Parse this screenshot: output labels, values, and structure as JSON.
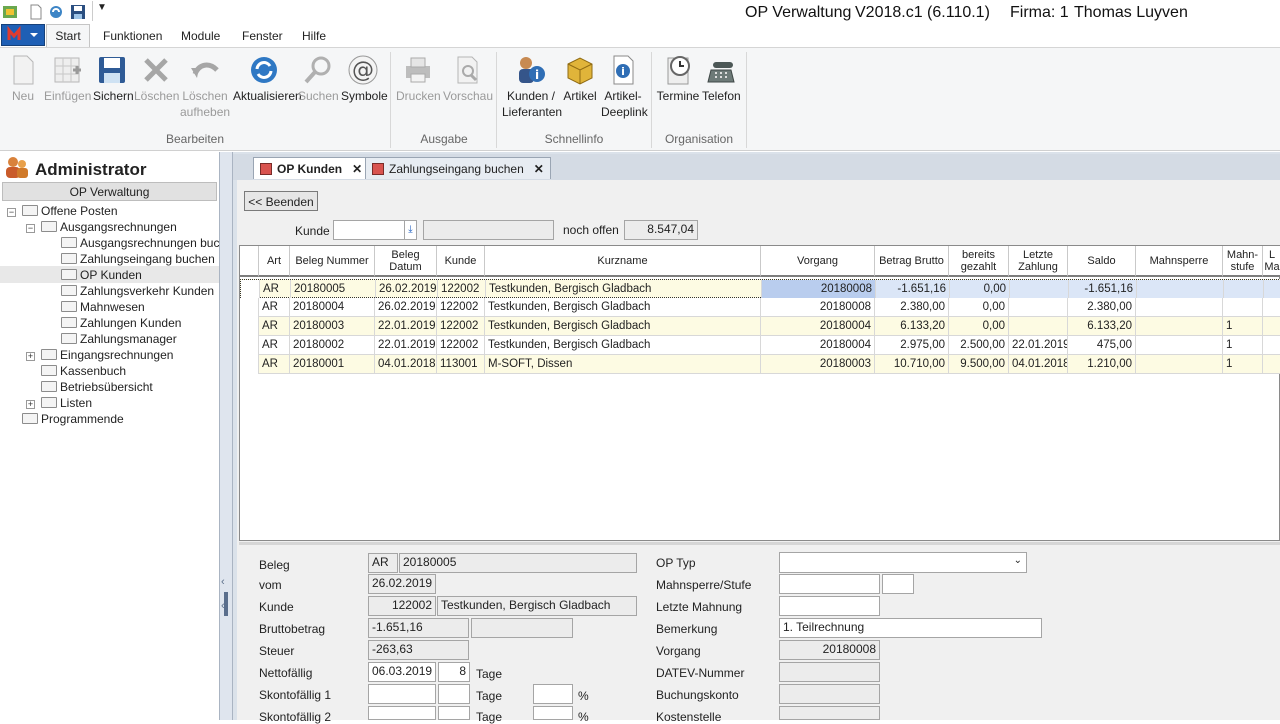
{
  "app": {
    "title": "OP Verwaltung",
    "version": "V2018.c1 (6.110.1)",
    "firma": "Firma: 1",
    "user": "Thomas Luyven"
  },
  "menu": [
    "Start",
    "Funktionen",
    "Module",
    "Fenster",
    "Hilfe"
  ],
  "ribbon": {
    "bearbeiten": {
      "label": "Bearbeiten",
      "buttons": [
        {
          "l1": "Neu",
          "l2": ""
        },
        {
          "l1": "Einfügen",
          "l2": ""
        },
        {
          "l1": "Sichern",
          "l2": ""
        },
        {
          "l1": "Löschen",
          "l2": ""
        },
        {
          "l1": "Löschen",
          "l2": "aufheben"
        },
        {
          "l1": "Aktualisieren",
          "l2": ""
        },
        {
          "l1": "Suchen",
          "l2": ""
        },
        {
          "l1": "Symbole",
          "l2": ""
        }
      ]
    },
    "ausgabe": {
      "label": "Ausgabe",
      "buttons": [
        {
          "l1": "Drucken",
          "l2": ""
        },
        {
          "l1": "Vorschau",
          "l2": ""
        }
      ]
    },
    "schnellinfo": {
      "label": "Schnellinfo",
      "buttons": [
        {
          "l1": "Kunden /",
          "l2": "Lieferanten"
        },
        {
          "l1": "Artikel",
          "l2": ""
        },
        {
          "l1": "Artikel-",
          "l2": "Deeplink"
        }
      ]
    },
    "organisation": {
      "label": "Organisation",
      "buttons": [
        {
          "l1": "Termine",
          "l2": ""
        },
        {
          "l1": "Telefon",
          "l2": ""
        }
      ]
    }
  },
  "left": {
    "header": "Administrator",
    "section": "OP Verwaltung",
    "tree": [
      "Offene Posten",
      "Ausgangsrechnungen",
      "Ausgangsrechnungen buchen",
      "Zahlungseingang buchen",
      "OP Kunden",
      "Zahlungsverkehr Kunden",
      "Mahnwesen",
      "Zahlungen Kunden",
      "Zahlungsmanager",
      "Eingangsrechnungen",
      "Kassenbuch",
      "Betriebsübersicht",
      "Listen",
      "Programmende"
    ]
  },
  "tabs": [
    "OP Kunden",
    "Zahlungseingang buchen"
  ],
  "toolbar": {
    "beenden": "<< Beenden",
    "kunde_label": "Kunde",
    "kunde_value": "",
    "kunde_name": "",
    "noch_offen_label": "noch offen",
    "noch_offen_value": "8.547,04"
  },
  "grid": {
    "headers": [
      "Art",
      "Beleg Nummer",
      "Beleg Datum",
      "Kunde",
      "Kurzname",
      "Vorgang",
      "Betrag Brutto",
      "bereits gezahlt",
      "Letzte Zahlung",
      "Saldo",
      "Mahnsperre",
      "Mahn- stufe",
      "L Ma"
    ],
    "rows": [
      [
        "AR",
        "20180005",
        "26.02.2019",
        "122002",
        "Testkunden, Bergisch Gladbach",
        "20180008",
        "-1.651,16",
        "0,00",
        "",
        "-1.651,16",
        "",
        "",
        ""
      ],
      [
        "AR",
        "20180004",
        "26.02.2019",
        "122002",
        "Testkunden, Bergisch Gladbach",
        "20180008",
        "2.380,00",
        "0,00",
        "",
        "2.380,00",
        "",
        "",
        ""
      ],
      [
        "AR",
        "20180003",
        "22.01.2019",
        "122002",
        "Testkunden, Bergisch Gladbach",
        "20180004",
        "6.133,20",
        "0,00",
        "",
        "6.133,20",
        "",
        "1",
        ""
      ],
      [
        "AR",
        "20180002",
        "22.01.2019",
        "122002",
        "Testkunden, Bergisch Gladbach",
        "20180004",
        "2.975,00",
        "2.500,00",
        "22.01.2019",
        "475,00",
        "",
        "1",
        ""
      ],
      [
        "AR",
        "20180001",
        "04.01.2018",
        "113001",
        "M-SOFT, Dissen",
        "20180003",
        "10.710,00",
        "9.500,00",
        "04.01.2018",
        "1.210,00",
        "",
        "1",
        ""
      ]
    ]
  },
  "detail": {
    "beleg_label": "Beleg",
    "beleg_art": "AR",
    "beleg_nr": "20180005",
    "vom_label": "vom",
    "vom": "26.02.2019",
    "kunde_label": "Kunde",
    "kunde_nr": "122002",
    "kunde_name": "Testkunden, Bergisch Gladbach",
    "brutto_label": "Bruttobetrag",
    "brutto": "-1.651,16",
    "steuer_label": "Steuer",
    "steuer": "-263,63",
    "netto_label": "Nettofällig",
    "netto": "06.03.2019",
    "netto_tage": "8",
    "tage": "Tage",
    "skonto1_label": "Skontofällig 1",
    "skonto2_label": "Skontofällig 2",
    "pct": "%",
    "optyp_label": "OP Typ",
    "optyp": "",
    "mahnsperre_label": "Mahnsperre/Stufe",
    "letzte_mahnung_label": "Letzte Mahnung",
    "bemerkung_label": "Bemerkung",
    "bemerkung": "1. Teilrechnung",
    "vorgang_label": "Vorgang",
    "vorgang": "20180008",
    "datev_label": "DATEV-Nummer",
    "buchungskonto_label": "Buchungskonto",
    "kostenstelle_label": "Kostenstelle"
  }
}
